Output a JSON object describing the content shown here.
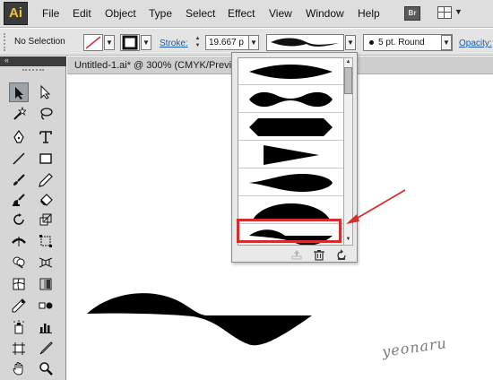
{
  "app": {
    "logo_text": "Ai"
  },
  "menu": {
    "items": [
      "File",
      "Edit",
      "Object",
      "Type",
      "Select",
      "Effect",
      "View",
      "Window",
      "Help"
    ],
    "bridge_label": "Br"
  },
  "control_bar": {
    "selection_label": "No Selection",
    "stroke_label": "Stroke:",
    "stroke_value": "19.667 p",
    "brush_label": "5 pt. Round",
    "opacity_label": "Opacity:"
  },
  "tools_panel": {
    "collapse_glyph": "«",
    "tools": [
      "selection-tool",
      "direct-selection-tool",
      "magic-wand-tool",
      "lasso-tool",
      "pen-tool",
      "type-tool",
      "line-segment-tool",
      "rectangle-tool",
      "paintbrush-tool",
      "pencil-tool",
      "blob-brush-tool",
      "eraser-tool",
      "rotate-tool",
      "scale-tool",
      "width-tool",
      "free-transform-tool",
      "shape-builder-tool",
      "perspective-grid-tool",
      "mesh-tool",
      "gradient-tool",
      "eyedropper-tool",
      "blend-tool",
      "symbol-sprayer-tool",
      "column-graph-tool",
      "artboard-tool",
      "slice-tool",
      "hand-tool",
      "zoom-tool"
    ]
  },
  "document": {
    "tab_title": "Untitled-1.ai* @ 300% (CMYK/Previ"
  },
  "profile_dropdown": {
    "profiles": [
      "width-profile-1-lens",
      "width-profile-2-wavy",
      "width-profile-3-hexagon",
      "width-profile-4-taper",
      "width-profile-5-leaf",
      "width-profile-6-dome",
      "width-profile-7-wave-flip"
    ],
    "selected_index": 6,
    "scroll_position": 0.0
  },
  "watermark": {
    "text": "yeonaru"
  },
  "colors": {
    "highlight": "#d62c2c",
    "arrow": "#d62c2c",
    "link_blue": "#1d5ba8",
    "logo_text": "#f3c23a"
  }
}
